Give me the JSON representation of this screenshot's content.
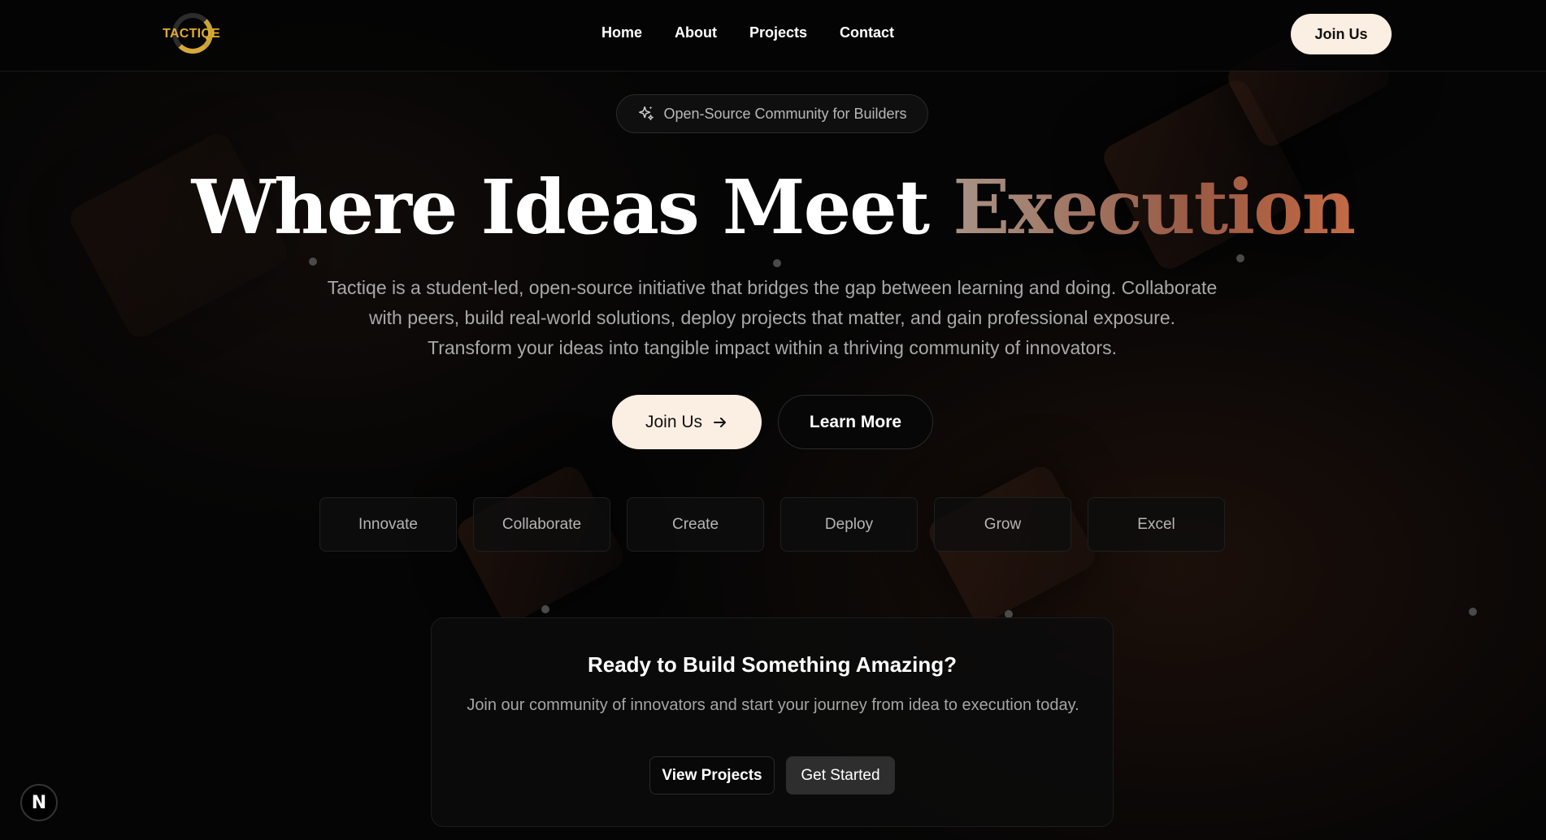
{
  "brand": {
    "logo_text": "TACTIQE"
  },
  "nav": {
    "links": [
      "Home",
      "About",
      "Projects",
      "Contact"
    ],
    "join_label": "Join Us"
  },
  "badge": {
    "text": "Open-Source Community for Builders",
    "icon": "sparkle-icon"
  },
  "hero": {
    "title_main": "Where Ideas Meet ",
    "title_accent": "Execution",
    "description": "Tactiqe is a student-led, open-source initiative that bridges the gap between learning and doing. Collaborate with peers, build real-world solutions, deploy projects that matter, and gain professional exposure. Transform your ideas into tangible impact within a thriving community of innovators.",
    "primary_button": "Join Us",
    "secondary_button": "Learn More"
  },
  "pills": [
    "Innovate",
    "Collaborate",
    "Create",
    "Deploy",
    "Grow",
    "Excel"
  ],
  "cta": {
    "title": "Ready to Build Something Amazing?",
    "description": "Join our community of innovators and start your journey from idea to execution today.",
    "view_button": "View Projects",
    "start_button": "Get Started"
  },
  "dev_badge": {
    "text": "N"
  },
  "colors": {
    "background": "#050505",
    "cream_button": "#fbeee2",
    "accent_start": "#a89385",
    "accent_end": "#c46a45",
    "logo_gold": "#e0ac2a"
  }
}
